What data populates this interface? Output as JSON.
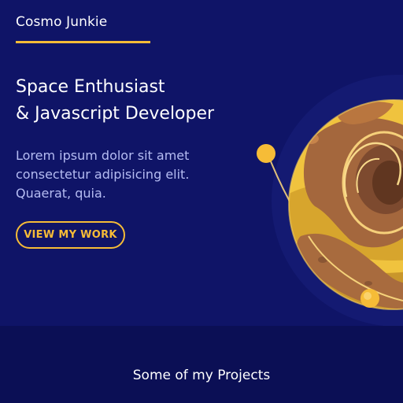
{
  "header": {
    "brand": "Cosmo Junkie"
  },
  "hero": {
    "headline_line1": "Space Enthusiast",
    "headline_line2": "& Javascript Developer",
    "intro": "Lorem ipsum dolor sit amet consectetur adipisicing elit. Quaerat, quia.",
    "cta_label": "VIEW MY WORK",
    "illustration_icon": "planet-with-orbit-icon"
  },
  "projects": {
    "title": "Some of my Projects"
  },
  "colors": {
    "background": "#0f1467",
    "section_background": "#0b0f55",
    "accent": "#f6bc37",
    "text": "#ffffff",
    "muted_text": "#b5bcf2"
  }
}
